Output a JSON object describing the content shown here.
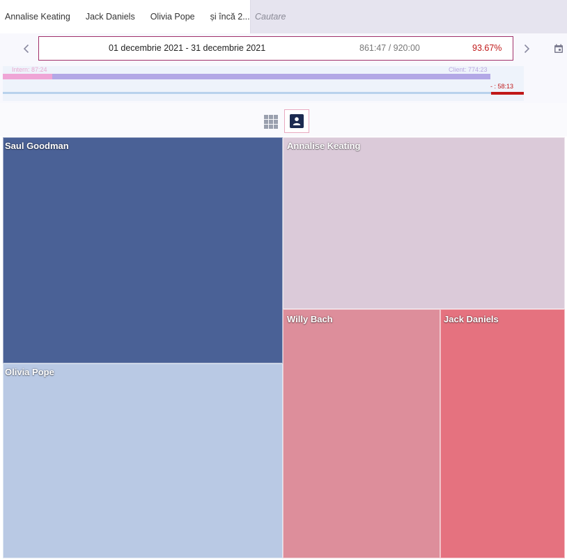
{
  "filters": {
    "tags": [
      "Annalise Keating",
      "Jack Daniels",
      "Olivia Pope",
      "și încă 2..."
    ],
    "search_placeholder": "Cautare"
  },
  "period": {
    "range": "01 decembrie 2021 - 31 decembrie 2021",
    "hours": "861:47 / 920:00",
    "percent": "93.67%",
    "intern_label": "Intern: 87:24",
    "client_label": "Client: 774:23",
    "overrun_label": "- : 58:13",
    "intern_share": 0.1014,
    "client_share": 0.8986,
    "used_fraction": 0.9367,
    "colors": {
      "intern": "#efa5d6",
      "client": "#b3a8e6",
      "overrun": "#c01818",
      "accent": "#a0306a"
    }
  },
  "icons": {
    "prev": "chevron-left-icon",
    "next": "chevron-right-icon",
    "calendar": "calendar-icon",
    "grid_view": "grid-icon",
    "person_view": "person-icon"
  },
  "treemap": {
    "tiles": [
      {
        "name": "Saul Goodman",
        "color": "#4a6196"
      },
      {
        "name": "Olivia Pope",
        "color": "#b9c9e4"
      },
      {
        "name": "Annalise Keating",
        "color": "#dbcad9"
      },
      {
        "name": "Willy Bach",
        "color": "#dd8e9b"
      },
      {
        "name": "Jack Daniels",
        "color": "#e5727f"
      }
    ]
  }
}
